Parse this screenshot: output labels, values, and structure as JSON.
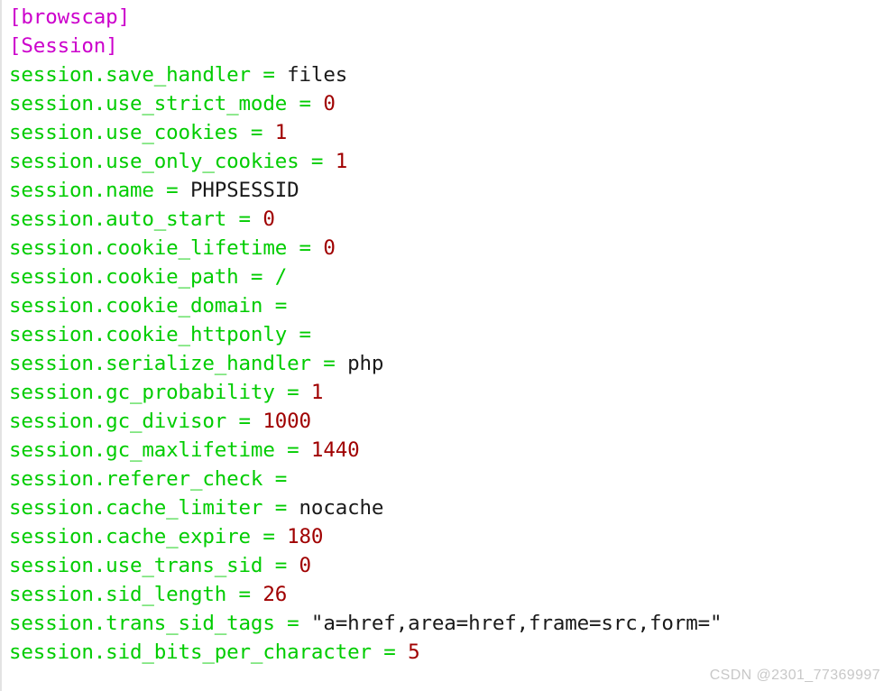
{
  "window": {
    "background_color": "#ffffff",
    "gutter_color": "#e3e3e3"
  },
  "theme": {
    "section_color": "#cc00cc",
    "key_color": "#00cc00",
    "operator_color": "#00cc00",
    "number_color": "#a00000",
    "string_color": "#1a1a1a",
    "cursor_background": "#00e000",
    "cursor_foreground": "#000000",
    "watermark_color": "#c8c8c8"
  },
  "editor": {
    "cursor": {
      "line_index": 23,
      "column": 0,
      "character": "s"
    },
    "lines": [
      {
        "type": "section",
        "text": "[browscap]"
      },
      {
        "type": "section",
        "text": "[Session]"
      },
      {
        "type": "setting",
        "key": "session.save_handler",
        "op": " = ",
        "value": "files",
        "value_type": "string"
      },
      {
        "type": "setting",
        "key": "session.use_strict_mode",
        "op": " = ",
        "value": "0",
        "value_type": "number"
      },
      {
        "type": "setting",
        "key": "session.use_cookies",
        "op": " = ",
        "value": "1",
        "value_type": "number"
      },
      {
        "type": "setting",
        "key": "session.use_only_cookies",
        "op": " = ",
        "value": "1",
        "value_type": "number"
      },
      {
        "type": "setting",
        "key": "session.name",
        "op": " = ",
        "value": "PHPSESSID",
        "value_type": "string"
      },
      {
        "type": "setting",
        "key": "session.auto_start",
        "op": " = ",
        "value": "0",
        "value_type": "number"
      },
      {
        "type": "setting",
        "key": "session.cookie_lifetime",
        "op": " = ",
        "value": "0",
        "value_type": "number"
      },
      {
        "type": "setting",
        "key": "session.cookie_path",
        "op": " = ",
        "value": "/",
        "value_type": "operator"
      },
      {
        "type": "setting",
        "key": "session.cookie_domain",
        "op": " =",
        "value": "",
        "value_type": "empty"
      },
      {
        "type": "setting",
        "key": "session.cookie_httponly",
        "op": " =",
        "value": "",
        "value_type": "empty"
      },
      {
        "type": "setting",
        "key": "session.serialize_handler",
        "op": " = ",
        "value": "php",
        "value_type": "string"
      },
      {
        "type": "setting",
        "key": "session.gc_probability",
        "op": " = ",
        "value": "1",
        "value_type": "number"
      },
      {
        "type": "setting",
        "key": "session.gc_divisor",
        "op": " = ",
        "value": "1000",
        "value_type": "number"
      },
      {
        "type": "setting",
        "key": "session.gc_maxlifetime",
        "op": " = ",
        "value": "1440",
        "value_type": "number"
      },
      {
        "type": "setting",
        "key": "session.referer_check",
        "op": " =",
        "value": "",
        "value_type": "empty"
      },
      {
        "type": "setting",
        "key": "session.cache_limiter",
        "op": " = ",
        "value": "nocache",
        "value_type": "string"
      },
      {
        "type": "setting",
        "key": "session.cache_expire",
        "op": " = ",
        "value": "180",
        "value_type": "number"
      },
      {
        "type": "setting",
        "key": "session.use_trans_sid",
        "op": " = ",
        "value": "0",
        "value_type": "number"
      },
      {
        "type": "setting",
        "key": "session.sid_length",
        "op": " = ",
        "value": "26",
        "value_type": "number"
      },
      {
        "type": "setting",
        "key": "session.trans_sid_tags",
        "op": " = ",
        "value": "\"a=href,area=href,frame=src,form=\"",
        "value_type": "string"
      },
      {
        "type": "setting",
        "key": "session.sid_bits_per_character",
        "op": " = ",
        "value": "5",
        "value_type": "number"
      }
    ]
  },
  "watermark": {
    "text": "CSDN @2301_77369997"
  }
}
